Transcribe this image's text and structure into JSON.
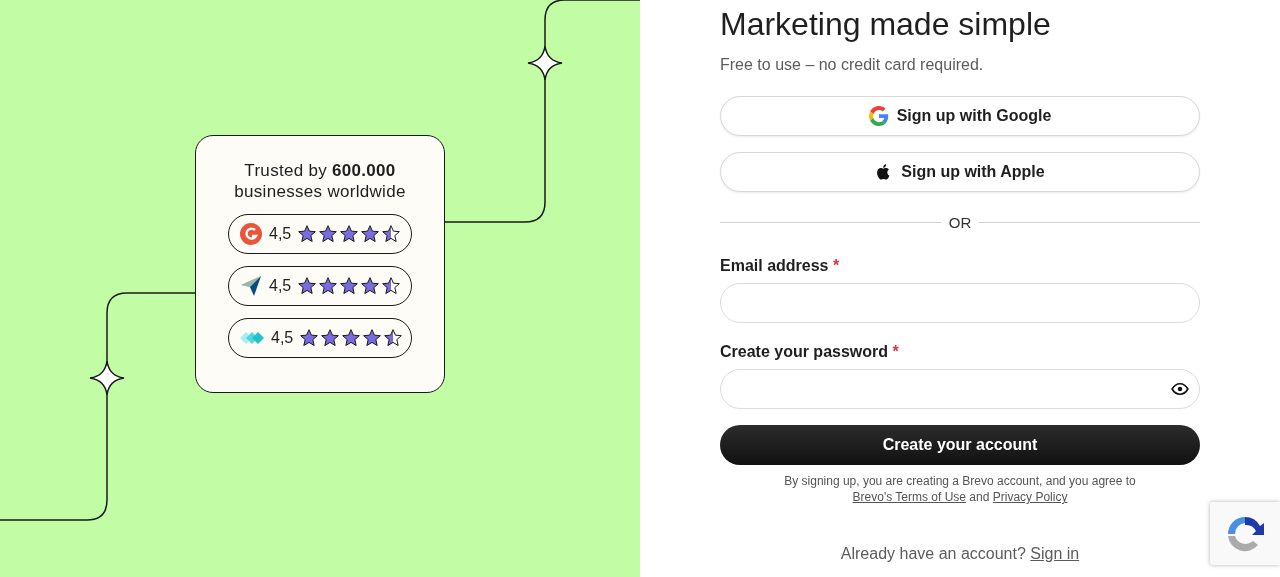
{
  "promo": {
    "headline": "Trusted by **600.000** businesses worldwide",
    "ratings": [
      {
        "kind": "g2",
        "score": "4,5",
        "stars": 4.5
      },
      {
        "kind": "capterra",
        "score": "4,5",
        "stars": 4.5
      },
      {
        "kind": "getapp",
        "score": "4,5",
        "stars": 4.5
      }
    ]
  },
  "form": {
    "title": "Marketing made simple",
    "subtitle": "Free to use – no credit card required.",
    "social_buttons": [
      {
        "kind": "google",
        "label": "Sign up with Google"
      },
      {
        "kind": "apple",
        "label": "Sign up with Apple"
      }
    ],
    "divider": "OR",
    "fields": [
      {
        "kind": "email",
        "label": "Email address",
        "required_mark": "*"
      },
      {
        "kind": "password",
        "label": "Create your password",
        "required_mark": "*"
      }
    ],
    "submit": "Create your account",
    "legal": {
      "text": "By signing up, you are creating a Brevo account, and you agree to",
      "terms_link": "Brevo's Terms of Use",
      "joiner": "and",
      "privacy_link": "Privacy Policy"
    },
    "signin": {
      "text": "Already have an account?",
      "link": "Sign in"
    }
  }
}
